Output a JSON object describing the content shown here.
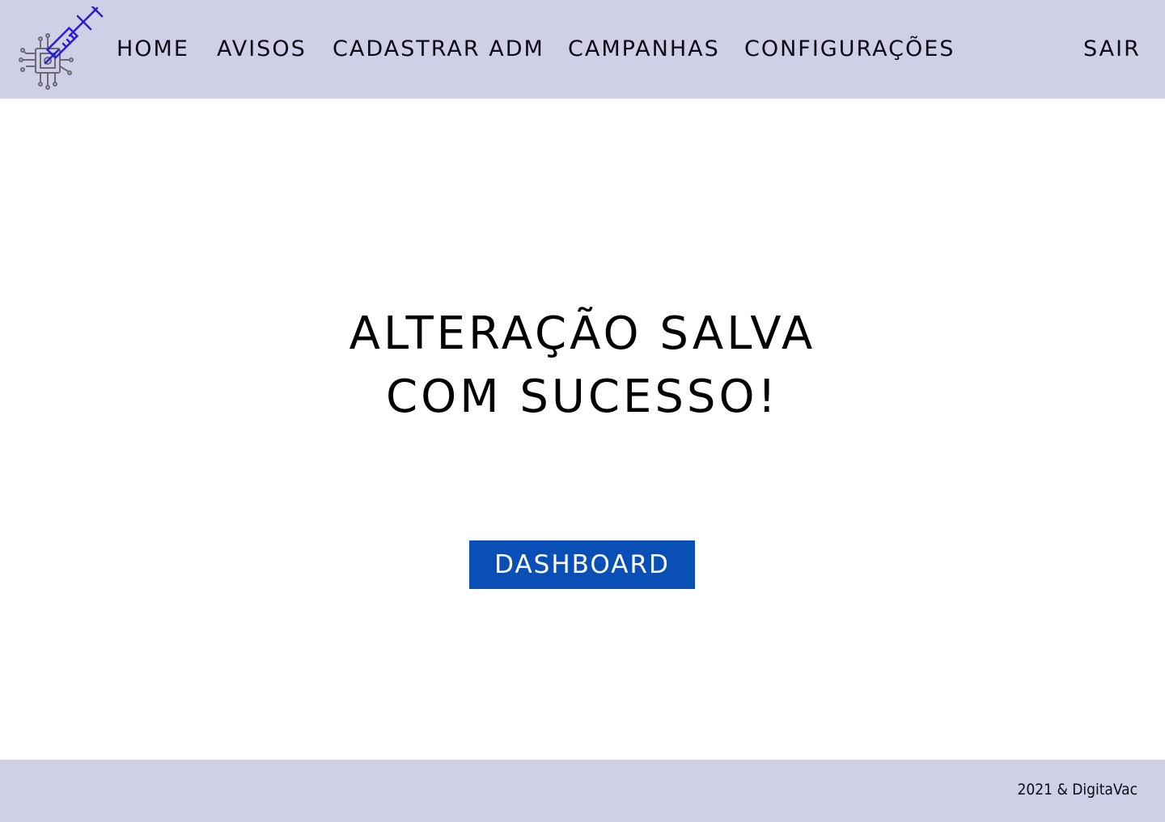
{
  "header": {
    "logo_icon": "syringe-chip-icon",
    "nav": {
      "home": "HOME",
      "avisos": "AVISOS",
      "cadastrar_adm": "CADASTRAR ADM",
      "campanhas": "CAMPANHAS",
      "configuracoes": "CONFIGURAÇÕES",
      "sair": "SAIR"
    }
  },
  "main": {
    "message_line1": "ALTERAÇÃO SALVA",
    "message_line2": "COM SUCESSO!",
    "dashboard_button": "DASHBOARD"
  },
  "footer": {
    "copyright": "2021 & DigitaVac"
  },
  "colors": {
    "bar_background": "#cfcfe6",
    "button_background": "#0a4fb5",
    "logo_accent": "#2a1fd0"
  }
}
